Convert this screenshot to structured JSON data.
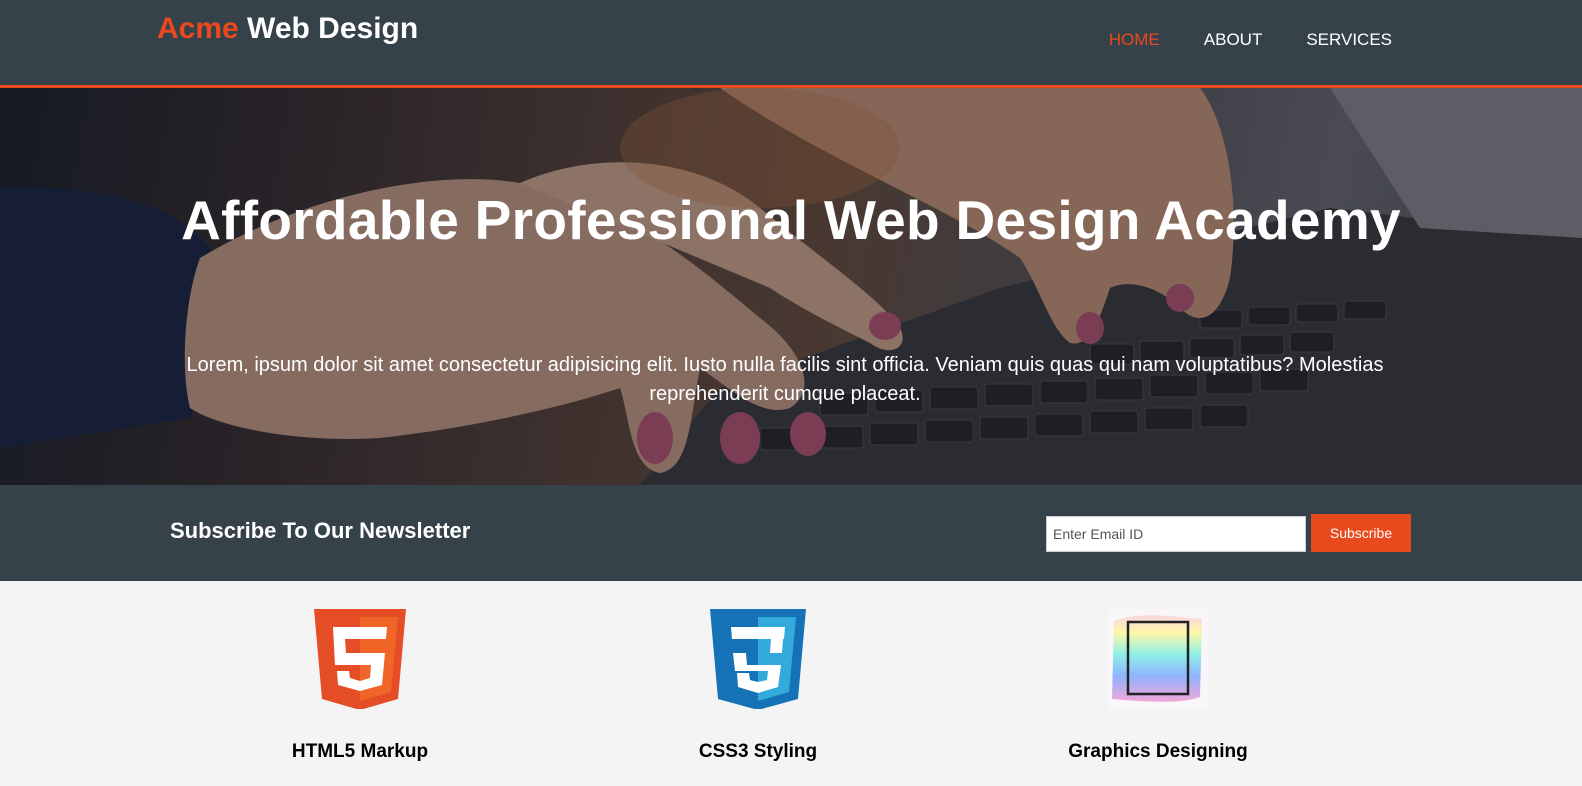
{
  "header": {
    "brand_highlight": "Acme",
    "brand_rest": " Web Design",
    "nav": [
      {
        "label": "HOME",
        "current": true
      },
      {
        "label": "ABOUT",
        "current": false
      },
      {
        "label": "SERVICES",
        "current": false
      }
    ]
  },
  "showcase": {
    "title": "Affordable Professional Web Design Academy",
    "lead": "Lorem, ipsum dolor sit amet consectetur adipisicing elit. Iusto nulla facilis sint officia. Veniam quis quas qui nam voluptatibus? Molestias reprehenderit cumque placeat."
  },
  "newsletter": {
    "heading": "Subscribe To Our Newsletter",
    "email_placeholder": "Enter Email ID",
    "email_value": "",
    "button_label": "Subscribe"
  },
  "boxes": [
    {
      "title": "HTML5 Markup",
      "icon": "html5-logo-icon"
    },
    {
      "title": "CSS3 Styling",
      "icon": "css3-logo-icon"
    },
    {
      "title": "Graphics Designing",
      "icon": "brush-frame-icon"
    }
  ],
  "colors": {
    "accent": "#e8491d",
    "header_bg": "#35424a",
    "page_bg": "#f4f4f4"
  }
}
